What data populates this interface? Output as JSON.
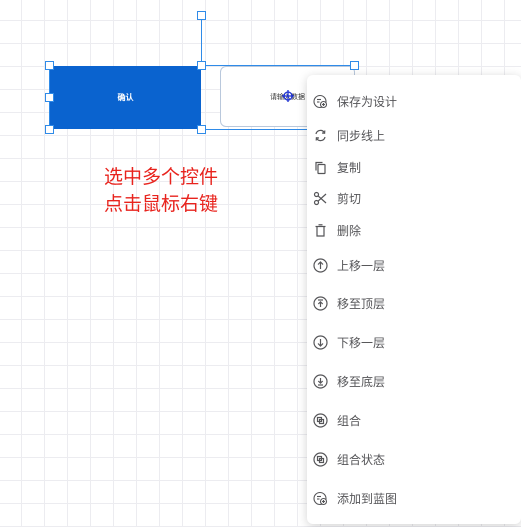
{
  "canvas": {
    "confirm_button": {
      "label": "确认"
    },
    "input_widget": {
      "text": "请输入数据"
    }
  },
  "annotation": {
    "line1": "选中多个控件",
    "line2": "点击鼠标右键"
  },
  "context_menu": {
    "items": [
      {
        "label": "保存为设计",
        "icon": "save-as-design-icon"
      },
      {
        "label": "同步线上",
        "icon": "sync-icon"
      },
      {
        "label": "复制",
        "icon": "copy-icon"
      },
      {
        "label": "剪切",
        "icon": "scissors-icon"
      },
      {
        "label": "删除",
        "icon": "trash-icon"
      },
      {
        "label": "上移一层",
        "icon": "arrow-up-circle-icon"
      },
      {
        "label": "移至顶层",
        "icon": "arrow-to-top-circle-icon"
      },
      {
        "label": "下移一层",
        "icon": "arrow-down-circle-icon"
      },
      {
        "label": "移至底层",
        "icon": "arrow-to-bottom-circle-icon"
      },
      {
        "label": "组合",
        "icon": "group-icon"
      },
      {
        "label": "组合状态",
        "icon": "group-state-icon"
      },
      {
        "label": "添加到蓝图",
        "icon": "add-to-blueprint-icon"
      }
    ]
  },
  "colors": {
    "accent": "#0a63cf",
    "selection": "#2f8be8",
    "annotation": "#e8231d",
    "menu_text": "#555558"
  }
}
